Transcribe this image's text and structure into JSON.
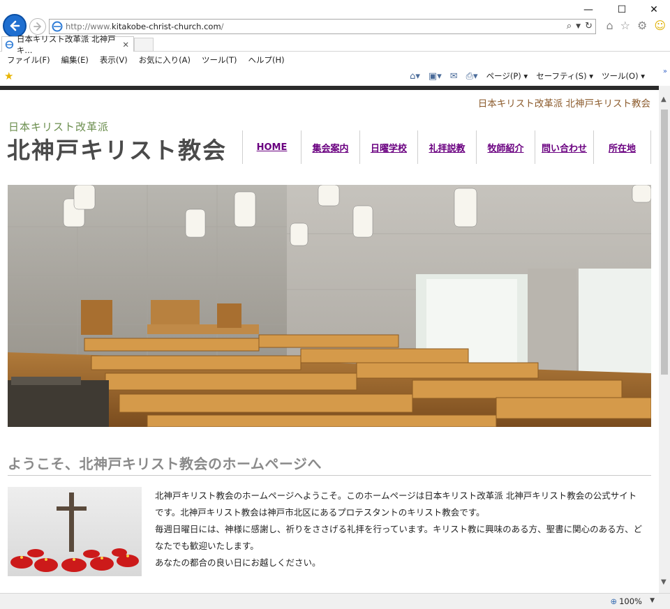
{
  "window": {
    "minimize": "—",
    "maximize": "☐",
    "close": "✕"
  },
  "address": {
    "prefix": "http://www.",
    "domain": "kitakobe-christ-church.com",
    "suffix": "/"
  },
  "tab": {
    "title": "日本キリスト改革派 北神戸キ...",
    "close": "✕"
  },
  "menu": [
    "ファイル(F)",
    "編集(E)",
    "表示(V)",
    "お気に入り(A)",
    "ツール(T)",
    "ヘルプ(H)"
  ],
  "command_bar": {
    "page": "ページ(P)",
    "safety": "セーフティ(S)",
    "tools": "ツール(O)"
  },
  "site": {
    "tagline": "日本キリスト改革派 北神戸キリスト教会",
    "logo_sub": "日本キリスト改革派",
    "logo_main": "北神戸キリスト教会",
    "nav": [
      "HOME",
      "集会案内",
      "日曜学校",
      "礼拝説教",
      "牧師紹介",
      "問い合わせ",
      "所在地"
    ],
    "welcome_heading": "ようこそ、北神戸キリスト教会のホームページへ",
    "intro_lines": [
      "北神戸キリスト教会のホームページへようこそ。このホームページは日本キリスト改革派 北神戸キリスト教会の公式サイト",
      "です。北神戸キリスト教会は神戸市北区にあるプロテスタントのキリスト教会です。",
      "毎週日曜日には、神様に感謝し、祈りをささげる礼拝を行っています。キリスト教に興味のある方、聖書に関心のある方、ど",
      "なたでも歓迎いたします。",
      "あなたの都合の良い日にお越しください。"
    ]
  },
  "status": {
    "zoom": "100%"
  },
  "colors": {
    "nav_link": "#6a0080",
    "tagline": "#8b5a2b",
    "logo_sub": "#6b8e4e",
    "ie_blue": "#1f6fd0"
  }
}
